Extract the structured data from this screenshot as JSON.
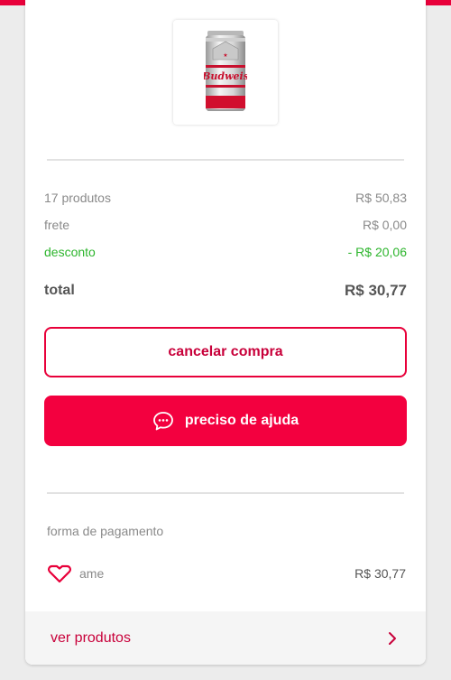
{
  "product": {
    "image_alt": "Budweiser can"
  },
  "summary": {
    "items_label": "17 produtos",
    "items_value": "R$ 50,83",
    "shipping_label": "frete",
    "shipping_value": "R$ 0,00",
    "discount_label": "desconto",
    "discount_value": "- R$ 20,06",
    "total_label": "total",
    "total_value": "R$ 30,77"
  },
  "actions": {
    "cancel_label": "cancelar compra",
    "help_label": "preciso de ajuda",
    "help_icon": "chat-bubble-icon"
  },
  "payment": {
    "section_label": "forma de pagamento",
    "method_icon": "ame-heart-icon",
    "method_name": "ame",
    "amount": "R$ 30,77"
  },
  "footer": {
    "link_label": "ver produtos",
    "chevron_icon": "chevron-right-icon"
  },
  "colors": {
    "accent": "#f3003f",
    "discount": "#2db52d"
  }
}
